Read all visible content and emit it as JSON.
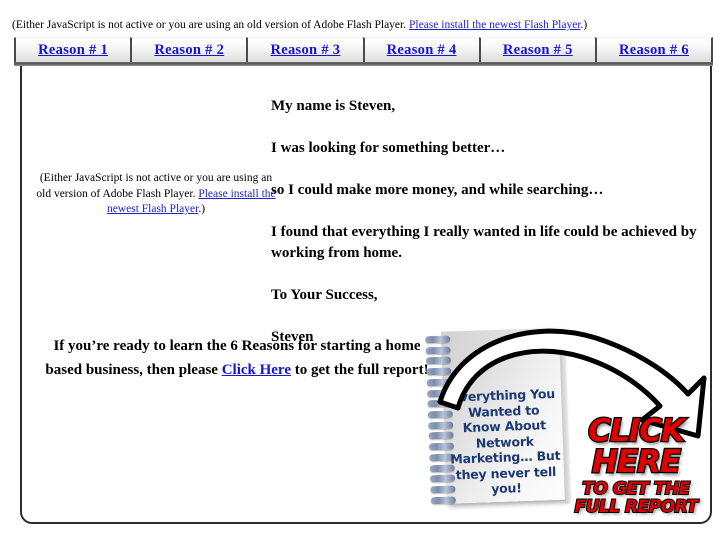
{
  "flash_notice": {
    "prefix": "(Either JavaScript is not active or you are using an old version of Adobe Flash Player. ",
    "link": "Please install the newest Flash Player",
    "suffix": ".)"
  },
  "flash_placeholder": {
    "prefix": "(Either JavaScript is not active or you are using an old version of Adobe Flash Player. ",
    "link": "Please install the newest Flash Player",
    "suffix": ".)"
  },
  "tabs": [
    {
      "label": "Reason # 1"
    },
    {
      "label": "Reason # 2"
    },
    {
      "label": "Reason # 3"
    },
    {
      "label": "Reason # 4"
    },
    {
      "label": "Reason # 5"
    },
    {
      "label": "Reason # 6"
    }
  ],
  "letter": {
    "line1": "My name is Steven,",
    "line2": "I was looking for something better…",
    "line3": "so I could make more money, and while searching…",
    "line4": "I found that everything I really wanted in life could be achieved by working from home.",
    "line5": "To Your Success,",
    "line6": "Steven"
  },
  "cta": {
    "before_link": "If you’re ready to learn the 6 Reasons for starting a home based business, then please ",
    "link": "Click Here",
    "after_link": " to get the full report!"
  },
  "report_graphic": {
    "notebook_text": "Everything You Wanted to Know About Network Marketing… But they never tell you!",
    "click_here": "CLICK HERE",
    "sub_line_1": "TO GET THE",
    "sub_line_2": "FULL REPORT"
  },
  "colors": {
    "link_blue": "#1515d0",
    "notebook_text": "#1b3a74",
    "stamp_red": "#e00000",
    "frame_border": "#2d2d2d"
  }
}
